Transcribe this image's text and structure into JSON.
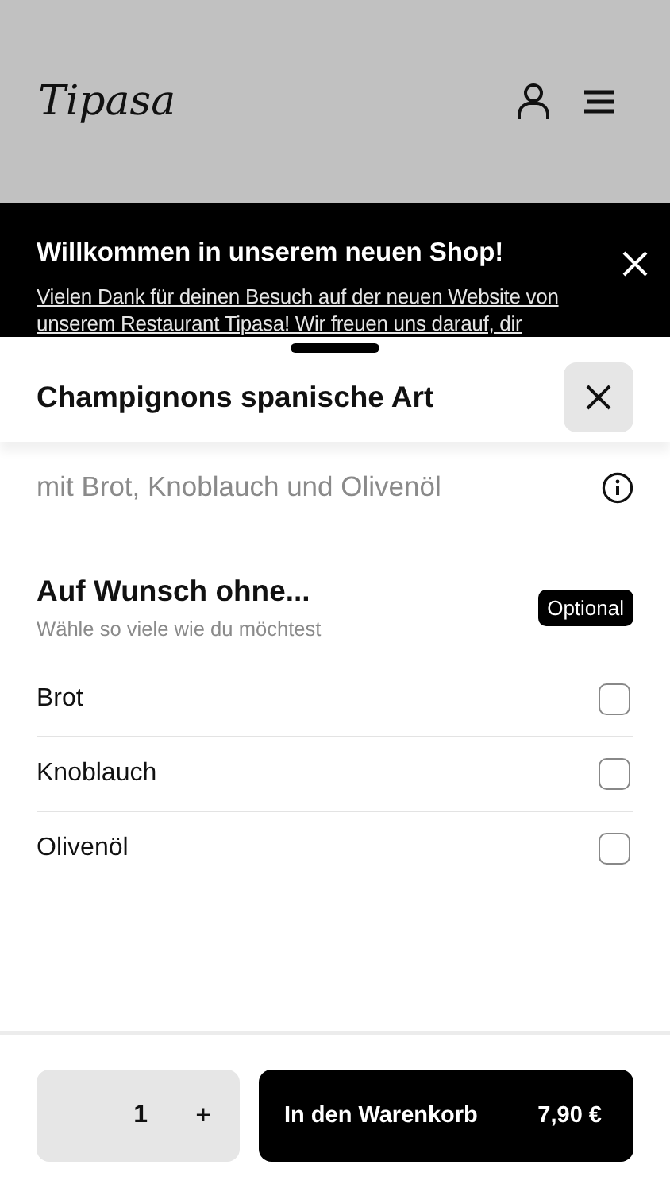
{
  "header": {
    "logo": "Tipasa"
  },
  "banner": {
    "title": "Willkommen in unserem neuen Shop!",
    "text": "Vielen Dank für deinen Besuch auf der neuen Website von unserem Restaurant Tipasa! Wir freuen uns darauf, dir"
  },
  "sheet": {
    "title": "Champignons spanische Art",
    "description": "mit Brot, Knoblauch und Olivenöl",
    "group": {
      "title": "Auf Wunsch ohne...",
      "subtitle": "Wähle so viele wie du möchtest",
      "badge": "Optional",
      "options": [
        {
          "label": "Brot",
          "checked": false
        },
        {
          "label": "Knoblauch",
          "checked": false
        },
        {
          "label": "Olivenöl",
          "checked": false
        }
      ]
    }
  },
  "footer": {
    "quantity": "1",
    "plus": "+",
    "cart_label": "In den Warenkorb",
    "price": "7,90 €"
  }
}
